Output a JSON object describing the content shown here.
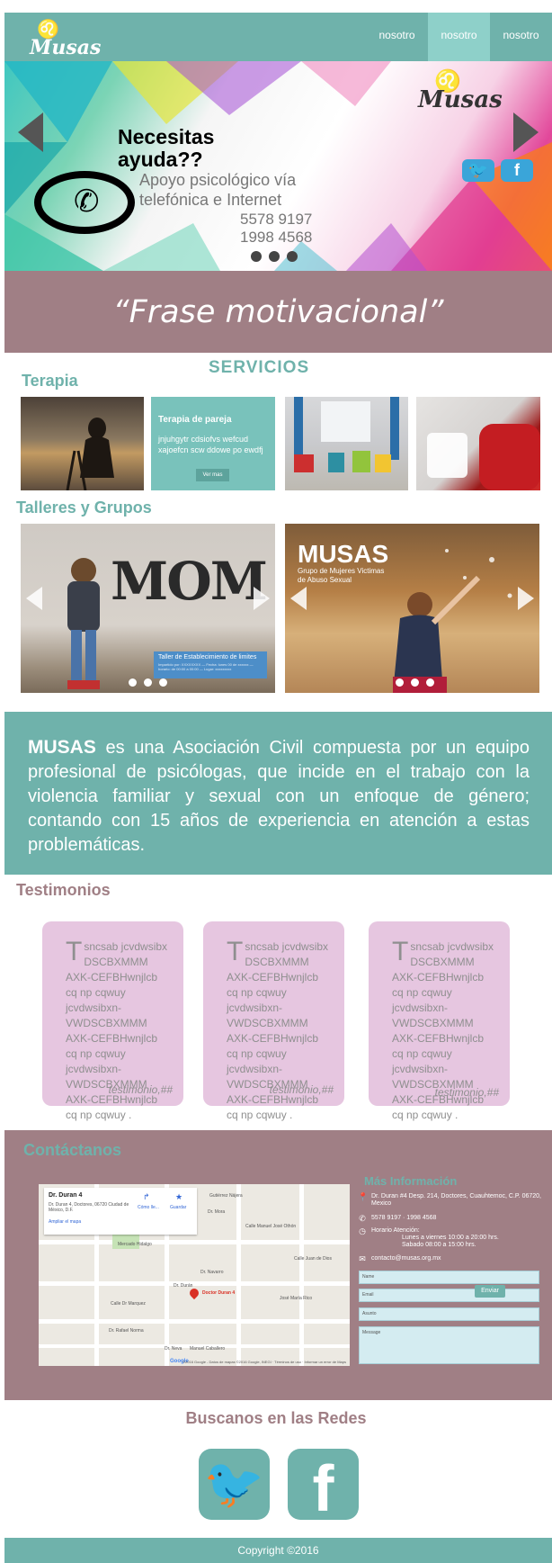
{
  "brand": {
    "logo_text": "Musas"
  },
  "nav": {
    "items": [
      "nosotro",
      "nosotro",
      "nosotro"
    ],
    "active_index": 1
  },
  "hero": {
    "title": "Necesitas ayuda??",
    "subtitle": "Apoyo psicológico vía telefónica e Internet",
    "phone1": "5578 9197",
    "phone2": "1998 4568",
    "logo_text": "Musas",
    "slides": 3,
    "active_slide": 0
  },
  "quote": "“Frase motivacional”",
  "services": {
    "title": "SERVICIOS",
    "terapia_title": "Terapia",
    "pareja_card": {
      "title": "Terapia de pareja",
      "text": "jnjuhgytr cdsiofvs  wefcud xajoefcn scw ddowe po ewdfj",
      "button": "Ver mas"
    },
    "talleres_title": "Talleres y Grupos",
    "banner1": {
      "graffiti": "MOM",
      "box_title": "Taller de Establecimiento de limites",
      "box_text": "Impartido por: XXXXXXXX — Fecha: lunes 00 de xxxxxx — horario: de 00:00 a 00:00 — Lugar: xxxxxxxxx"
    },
    "banner2": {
      "title": "MUSAS",
      "subtitle": "Grupo de Mujeres Victimas de Abuso Sexual"
    }
  },
  "about": {
    "lead": "MUSAS",
    "text": " es una Asociación Civil compuesta por un equipo profesional de psicólogas, que incide en el trabajo con la violencia familiar y sexual con un enfoque de género; contando con 15 años de experiencia en atención a estas problemáticas."
  },
  "testimonios": {
    "title": "Testimonios",
    "items": [
      {
        "cap": "T",
        "text": "sncsab  jcvdwsibx DSCBXMMM AXK-CEFBHwnjlcb cq  np cqwuy jcvdwsibxn-VWDSCBXMMM AXK-CEFBHwnjlcb cq  np cqwuy jcvdwsibxn-VWDSCBXMMM AXK-CEFBHwnjlcb cq  np cqwuy .",
        "sig": "testimonio,##"
      },
      {
        "cap": "T",
        "text": "sncsab  jcvdwsibx DSCBXMMM AXK-CEFBHwnjlcb cq  np cqwuy jcvdwsibxn-VWDSCBXMMM AXK-CEFBHwnjlcb cq  np cqwuy jcvdwsibxn-VWDSCBXMMM AXK-CEFBHwnjlcb cq  np cqwuy .",
        "sig": "testimonio,##"
      },
      {
        "cap": "T",
        "text": "sncsab  jcvdwsibx DSCBXMMM AXK-CEFBHwnjlcb cq  np cqwuy jcvdwsibxn-VWDSCBXMMM AXK-CEFBHwnjlcb cq  np cqwuy jcvdwsibxn-VWDSCBXMMM AXK-CEFBHwnjlcb cq  np cqwuy .",
        "sig": "testimonio,##"
      }
    ]
  },
  "contact": {
    "title": "Contáctanos",
    "map": {
      "place_name": "Dr. Duran 4",
      "place_address": "Dr. Duran 4, Doctores, 06720 Ciudad de México, D.F.",
      "link": "Ampliar el mapa",
      "directions": "Cómo lle...",
      "save": "Guardar",
      "pin_label": "Doctor Duran 4",
      "streets": [
        "Gutiérrez Nájera",
        "Dr. Mora",
        "Calle Manuel José Othón",
        "Mercado Hidalgo",
        "Dr. Navarro",
        "Dr. Durán",
        "Calle Dr Marquez",
        "Dr. Rafael Norma",
        "José María Rico",
        "Dr. Neva",
        "Manuel Caballero",
        "Calle Juan de Dios"
      ],
      "attribution": "©2016 Google - Datos de mapas ©2016 Google, INEGI · Términos de uso · Informar un error de Maps",
      "google": "Google"
    },
    "more_title": "Más Información",
    "address": "Dr. Duran #4 Desp. 214, Doctores, Cuauhtemoc, C.P. 06720, Mexico",
    "phones": "5578 9197 · 1998 4568",
    "hours_label": "Horario Atención:",
    "hours_week": "Lunes a viernes 10:00 a 20:00 hrs.",
    "hours_sat": "Sabado 08:00 a 15:00 hrs.",
    "email": "contacto@musas.org.mx",
    "form": {
      "name_placeholder": "Name",
      "email_placeholder": "Email",
      "subject_placeholder": "Asunto",
      "message_placeholder": "Message",
      "send_label": "Enviar"
    }
  },
  "redes": {
    "title": "Buscanos en las Redes"
  },
  "footer": {
    "copyright": "Copyright ©2016"
  }
}
